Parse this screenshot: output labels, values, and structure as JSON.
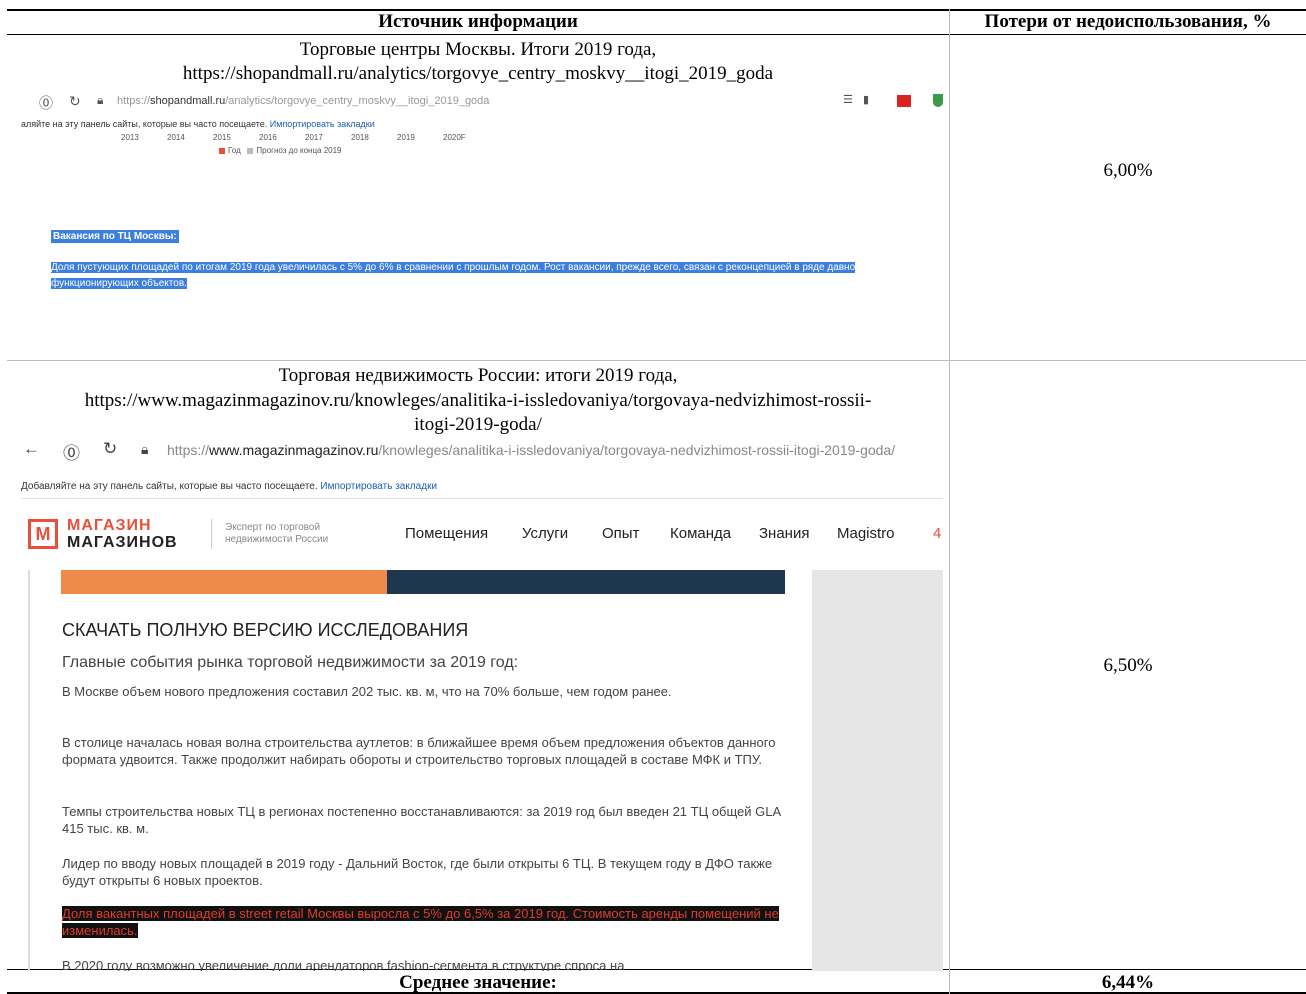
{
  "table": {
    "header": {
      "source": "Источник информации",
      "loss": "Потери от недоиспользования, %"
    },
    "rows": [
      {
        "caption_line1": "Торговые центры Москвы. Итоги 2019 года,",
        "caption_line2": "https://shopandmall.ru/analytics/torgovye_centry_moskvy__itogi_2019_goda",
        "value": "6,00%",
        "screenshot": {
          "url_prefix": "https://",
          "url_domain": "shopandmall.ru",
          "url_path": "/analytics/torgovye_centry_moskvy__itogi_2019_goda",
          "bookmarks_text": "аляйте на эту панель сайты, которые вы часто посещаете.",
          "bookmarks_link": "Импортировать закладки",
          "years": [
            "2013",
            "2014",
            "2015",
            "2016",
            "2017",
            "2018",
            "2019",
            "2020F"
          ],
          "legend_fact": "Год",
          "legend_forecast": "Прогноз до конца 2019",
          "heading": "Вакансия по ТЦ Москвы:",
          "paragraph": "Доля пустующих площадей по итогам 2019 года увеличилась с 5% до 6% в сравнении с прошлым годом. Рост вакансии, прежде всего, связан с реконцепцией в ряде давно функционирующих объектов."
        }
      },
      {
        "caption_line1": "Торговая недвижимость России: итоги 2019 года,",
        "caption_line2": "https://www.magazinmagazinov.ru/knowleges/analitika-i-issledovaniya/torgovaya-nedvizhimost-rossii-",
        "caption_line3": "itogi-2019-goda/",
        "value": "6,50%",
        "screenshot": {
          "url_prefix": "https://",
          "url_domain": "www.magazinmagazinov.ru",
          "url_path": "/knowleges/analitika-i-issledovaniya/torgovaya-nedvizhimost-rossii-itogi-2019-goda/",
          "bookmarks_text": "Добавляйте на эту панель сайты, которые вы часто посещаете.",
          "bookmarks_link": "Импортировать закладки",
          "logo_letter": "М",
          "logo_line1": "МАГАЗИН",
          "logo_line2": "МАГАЗИНОВ",
          "logo_sub1": "Эксперт по торговой",
          "logo_sub2": "недвижимости России",
          "nav": [
            "Помещения",
            "Услуги",
            "Опыт",
            "Команда",
            "Знания",
            "Magistro"
          ],
          "nav_edge": "4",
          "title": "СКАЧАТЬ ПОЛНУЮ ВЕРСИЮ ИССЛЕДОВАНИЯ",
          "subtitle": "Главные события рынка торговой недвижимости за 2019 год:",
          "p1": "В Москве объем нового предложения составил 202 тыс. кв. м, что на 70% больше, чем годом ранее.",
          "p2": "В столице началась новая волна строительства аутлетов: в ближайшее время объем предложения объектов данного формата удвоится. Также продолжит набирать обороты и строительство торговых площадей в составе МФК и ТПУ.",
          "p3": "Темпы строительства новых ТЦ в регионах постепенно восстанавливаются: за 2019 год был введен 21 ТЦ общей GLA 415 тыс. кв. м.",
          "p4": "Лидер по вводу новых площадей в 2019 году - Дальний Восток, где были открыты 6 ТЦ. В текущем году в ДФО также будут открыты 6 новых проектов.",
          "p5_highlight": "Доля вакантных площадей в street retail Москвы выросла с 5% до 6,5% за 2019 год. Стоимость аренды помещений не изменилась.",
          "p6": "В 2020 году возможно увеличение доли арендаторов fashion-сегмента в структуре спроса на"
        }
      }
    ],
    "footer": {
      "label": "Среднее значение:",
      "value": "6,44%"
    }
  },
  "colors": {
    "highlight_blue": "#3d7fe0",
    "brand_orange": "#e8503a",
    "link_blue": "#1a5fb4"
  }
}
